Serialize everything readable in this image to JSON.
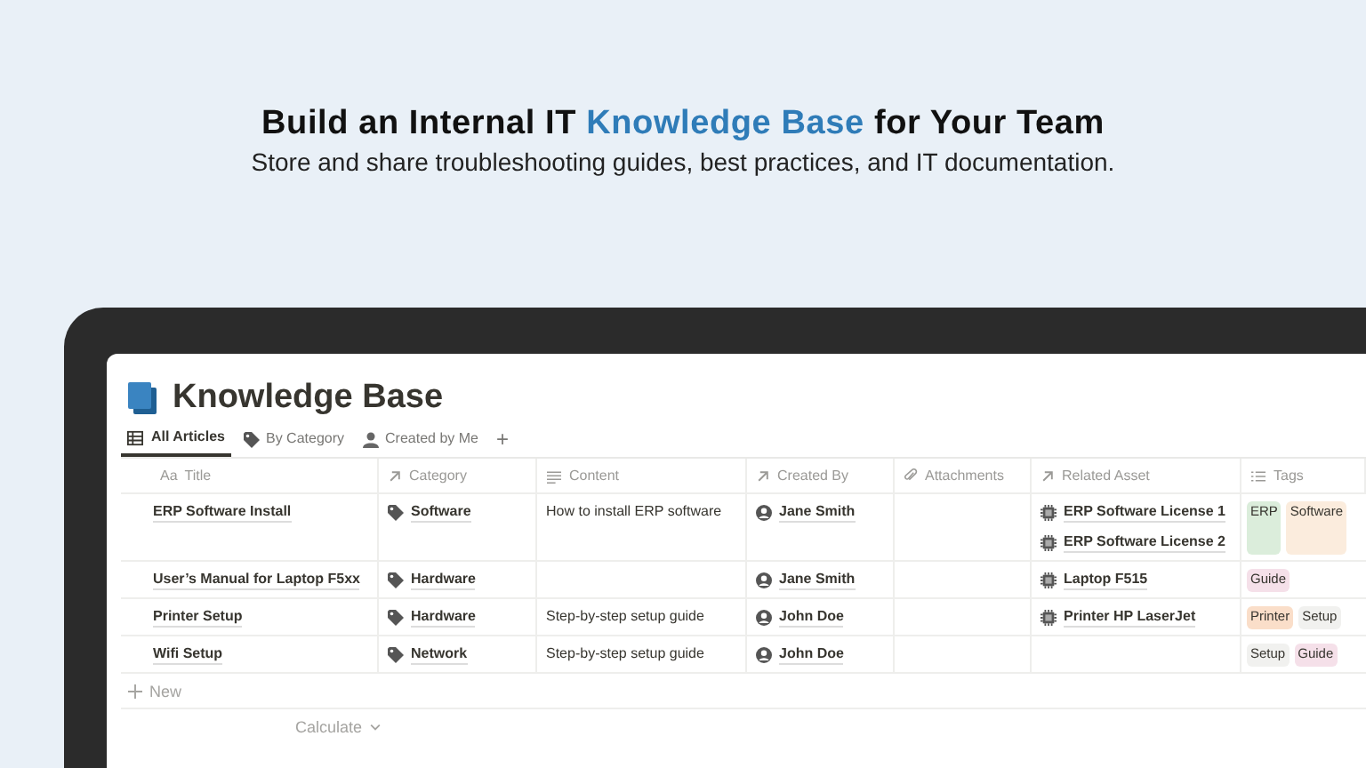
{
  "headline": {
    "before": "Build an Internal IT ",
    "highlight": "Knowledge Base",
    "after": " for Your Team"
  },
  "subtitle": "Store and share troubleshooting guides, best practices, and IT documentation.",
  "page": {
    "title": "Knowledge Base"
  },
  "views": [
    {
      "label": "All Articles",
      "selected": true
    },
    {
      "label": "By Category",
      "selected": false
    },
    {
      "label": "Created by Me",
      "selected": false
    }
  ],
  "add_view": "+",
  "table": {
    "columns": [
      {
        "label": "Title",
        "prefix": "Aa"
      },
      {
        "label": "Category"
      },
      {
        "label": "Content"
      },
      {
        "label": "Created By"
      },
      {
        "label": "Attachments"
      },
      {
        "label": "Related Asset"
      },
      {
        "label": "Tags"
      }
    ],
    "rows": [
      {
        "title": "ERP Software Install",
        "category": "Software",
        "content": "How to install ERP software",
        "created_by": "Jane Smith",
        "related_assets": [
          "ERP Software License 1",
          "ERP Software License 2"
        ],
        "tags": [
          {
            "label": "ERP",
            "color": "#dbeddb"
          },
          {
            "label": "Software",
            "color": "#fbecdd"
          }
        ]
      },
      {
        "title": "User’s Manual for Laptop F5xx",
        "category": "Hardware",
        "content": "",
        "created_by": "Jane Smith",
        "related_assets": [
          "Laptop F515"
        ],
        "tags": [
          {
            "label": "Guide",
            "color": "#f5e0e9"
          }
        ]
      },
      {
        "title": "Printer Setup",
        "category": "Hardware",
        "content": "Step-by-step setup guide",
        "created_by": "John Doe",
        "related_assets": [
          "Printer HP LaserJet"
        ],
        "tags": [
          {
            "label": "Printer",
            "color": "#fadec9"
          },
          {
            "label": "Setup",
            "color": "#f1f1ef"
          }
        ]
      },
      {
        "title": "Wifi Setup",
        "category": "Network",
        "content": "Step-by-step setup guide",
        "created_by": "John Doe",
        "related_assets": [],
        "tags": [
          {
            "label": "Setup",
            "color": "#f1f1ef"
          },
          {
            "label": "Guide",
            "color": "#f5e0e9"
          }
        ]
      }
    ],
    "new_row": "New",
    "calculate": "Calculate"
  }
}
